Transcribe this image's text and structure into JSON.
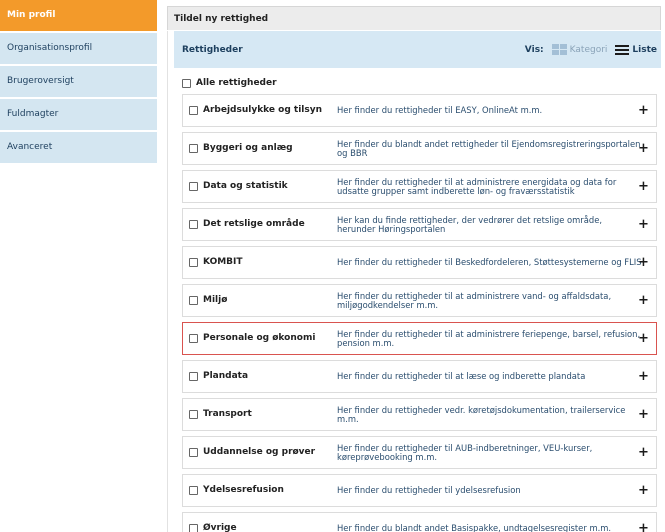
{
  "sidebar": {
    "items": [
      {
        "label": "Min profil"
      },
      {
        "label": "Organisationsprofil"
      },
      {
        "label": "Brugeroversigt"
      },
      {
        "label": "Fuldmagter"
      },
      {
        "label": "Avanceret"
      }
    ]
  },
  "panel": {
    "title": "Tildel ny rettighed",
    "header_label": "Rettigheder",
    "vis_label": "Vis:",
    "view_category": "Kategori",
    "view_list": "Liste",
    "all_label": "Alle rettigheder"
  },
  "rights": [
    {
      "title": "Arbejdsulykke og tilsyn",
      "desc": "Her finder du rettigheder til EASY, OnlineAt m.m."
    },
    {
      "title": "Byggeri og anlæg",
      "desc": "Her finder du blandt andet rettigheder til Ejendomsregistreringsportalen og BBR"
    },
    {
      "title": "Data og statistik",
      "desc": "Her finder du rettigheder til at administrere energidata og data for udsatte grupper samt indberette løn- og fraværsstatistik"
    },
    {
      "title": "Det retslige område",
      "desc": "Her kan du finde rettigheder, der vedrører det retslige område, herunder Høringsportalen"
    },
    {
      "title": "KOMBIT",
      "desc": "Her finder du rettigheder til Beskedfordeleren, Støttesystemerne og FLIS"
    },
    {
      "title": "Miljø",
      "desc": "Her finder du rettigheder til at administrere vand- og affaldsdata, miljøgodkendelser m.m."
    },
    {
      "title": "Personale og økonomi",
      "desc": "Her finder du rettigheder til at administrere feriepenge, barsel, refusion, pension m.m."
    },
    {
      "title": "Plandata",
      "desc": "Her finder du rettigheder til at læse og indberette plandata"
    },
    {
      "title": "Transport",
      "desc": "Her finder du rettigheder vedr. køretøjsdokumentation, trailerservice m.m."
    },
    {
      "title": "Uddannelse og prøver",
      "desc": "Her finder du rettigheder til AUB-indberetninger, VEU-kurser, køreprøvebooking m.m."
    },
    {
      "title": "Ydelsesrefusion",
      "desc": "Her finder du rettigheder til ydelsesrefusion"
    },
    {
      "title": "Øvrige",
      "desc": "Her finder du blandt andet Basispakke, undtagelsesregister m.m."
    }
  ],
  "icons": {
    "expand": "+"
  },
  "colors": {
    "active_nav": "#f39a2a",
    "nav_bg": "#d4e6f1",
    "header_bg": "#d6e8f4",
    "highlight_border": "#d9534f"
  }
}
